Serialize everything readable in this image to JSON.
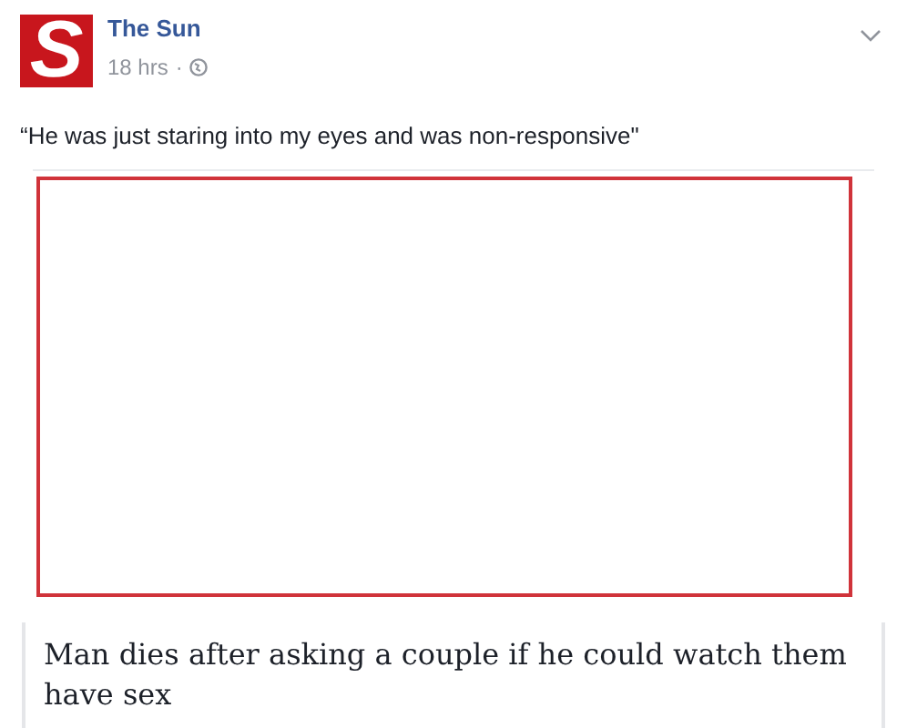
{
  "post": {
    "logo_letter": "S",
    "page_name": "The Sun",
    "time": "18 hrs",
    "separator": "·",
    "caption": "“He was just staring into my eyes and was non-responsive\""
  },
  "attachment": {
    "headline": "Man dies after asking a couple if he could watch them have sex"
  }
}
